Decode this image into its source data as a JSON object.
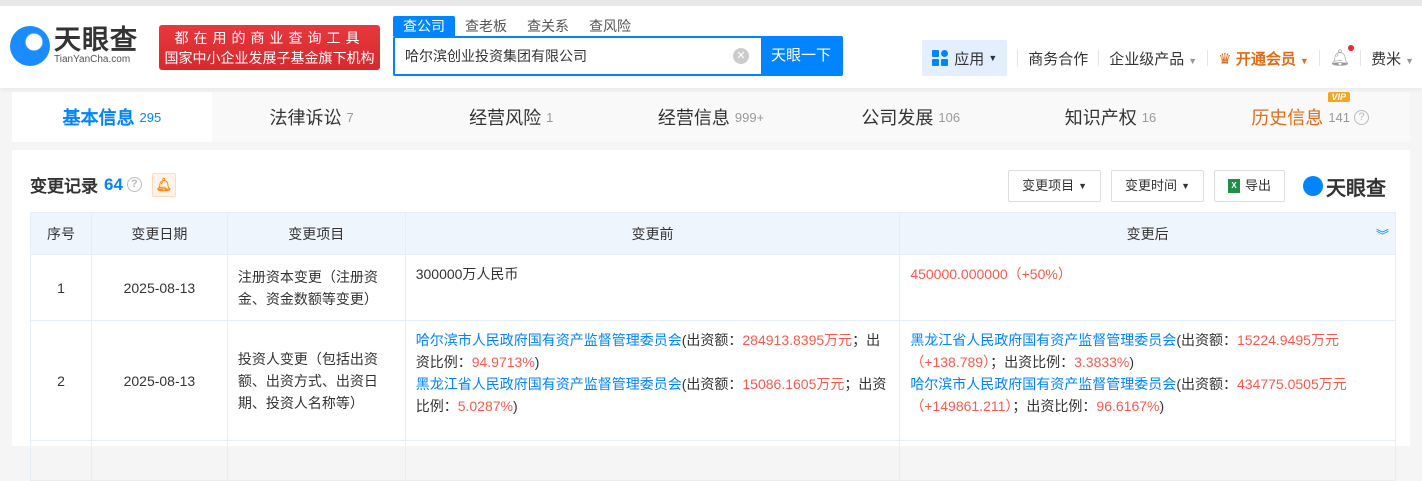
{
  "header": {
    "logo_cn": "天眼查",
    "logo_en": "TianYanCha.com",
    "slogan_line1": "都在用的商业查询工具",
    "slogan_line2": "国家中小企业发展子基金旗下机构",
    "search_tabs": [
      "查公司",
      "查老板",
      "查关系",
      "查风险"
    ],
    "search_value": "哈尔滨创业投资集团有限公司",
    "search_button": "天眼一下",
    "nav": {
      "app": "应用",
      "business": "商务合作",
      "enterprise": "企业级产品",
      "vip": "开通会员",
      "user": "费米"
    }
  },
  "tabs": [
    {
      "label": "基本信息",
      "count": "295"
    },
    {
      "label": "法律诉讼",
      "count": "7"
    },
    {
      "label": "经营风险",
      "count": "1"
    },
    {
      "label": "经营信息",
      "count": "999+"
    },
    {
      "label": "公司发展",
      "count": "106"
    },
    {
      "label": "知识产权",
      "count": "16"
    },
    {
      "label": "历史信息",
      "count": "141",
      "badge": "VIP"
    }
  ],
  "section": {
    "title": "变更记录",
    "count": "64",
    "filter_item": "变更项目",
    "filter_time": "变更时间",
    "export": "导出",
    "brand": "天眼查"
  },
  "table": {
    "headers": [
      "序号",
      "变更日期",
      "变更项目",
      "变更前",
      "变更后"
    ],
    "rows": [
      {
        "index": "1",
        "date": "2025-08-13",
        "item": "注册资本变更（注册资金、资金数额等变更）",
        "before": "300000万人民币",
        "after": "450000.000000（+50%）"
      },
      {
        "index": "2",
        "date": "2025-08-13",
        "item": "投资人变更（包括出资额、出资方式、出资日期、投资人名称等）",
        "before": [
          {
            "name": "哈尔滨市人民政府国有资产监督管理委员会",
            "amount": "284913.8395万元",
            "ratio": "94.9713%"
          },
          {
            "name": "黑龙江省人民政府国有资产监督管理委员会",
            "amount": "15086.1605万元",
            "ratio": "5.0287%"
          }
        ],
        "after": [
          {
            "name": "黑龙江省人民政府国有资产监督管理委员会",
            "amount": "15224.9495万元（+138.789）",
            "ratio": "3.3833%"
          },
          {
            "name": "哈尔滨市人民政府国有资产监督管理委员会",
            "amount": "434775.0505万元（+149861.211）",
            "ratio": "96.6167%"
          }
        ]
      }
    ],
    "labels": {
      "amount": "(出资额：",
      "ratio": "；出资比例：",
      "close": ")"
    }
  }
}
